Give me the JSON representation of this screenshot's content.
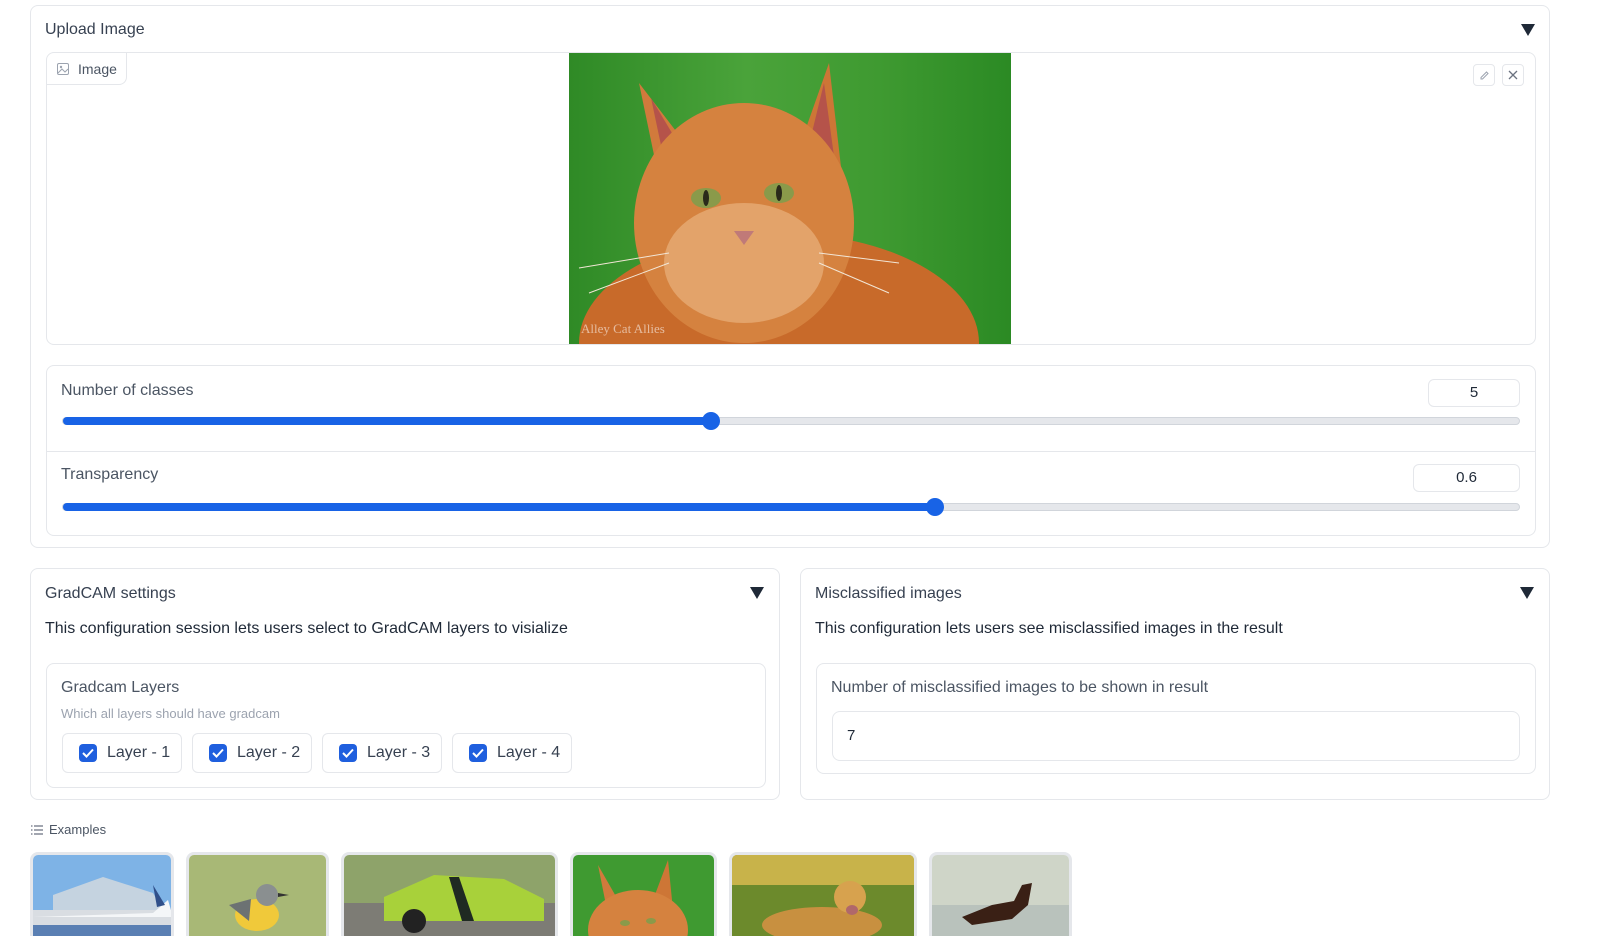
{
  "upload_panel": {
    "title": "Upload Image",
    "image_label": "Image",
    "watermark": "Alley Cat Allies"
  },
  "sliders": {
    "num_classes": {
      "label": "Number of classes",
      "value": "5",
      "fraction": 0.445
    },
    "transparency": {
      "label": "Transparency",
      "value": "0.6",
      "fraction": 0.599
    }
  },
  "gradcam_panel": {
    "title": "GradCAM settings",
    "description": "This configuration session lets users select to GradCAM layers to visialize",
    "group_label": "Gradcam Layers",
    "group_info": "Which all layers should have gradcam",
    "layers": [
      {
        "label": "Layer - 1",
        "checked": true
      },
      {
        "label": "Layer - 2",
        "checked": true
      },
      {
        "label": "Layer - 3",
        "checked": true
      },
      {
        "label": "Layer - 4",
        "checked": true
      }
    ]
  },
  "misclassified_panel": {
    "title": "Misclassified images",
    "description": "This configuration lets users see misclassified images in the result",
    "field_label": "Number of misclassified images to be shown in result",
    "field_value": "7"
  },
  "examples": {
    "label": "Examples",
    "items": [
      "airplane",
      "bird",
      "car",
      "cat",
      "dog",
      "horse"
    ]
  },
  "colors": {
    "accent": "#1863e6"
  }
}
